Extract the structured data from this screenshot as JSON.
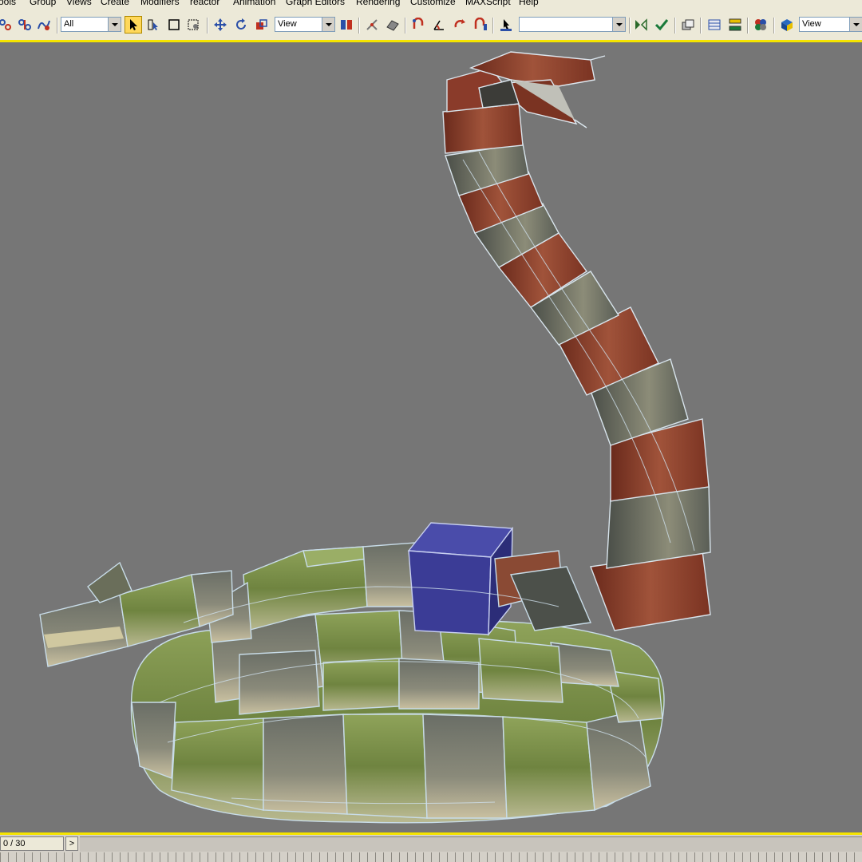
{
  "menu": {
    "items": [
      "ools",
      "Group",
      "Views",
      "Create",
      "Modifiers",
      "reactor",
      "Animation",
      "Graph Editors",
      "Rendering",
      "Customize",
      "MAXScript",
      "Help"
    ]
  },
  "toolbar": {
    "selection_filter": "All",
    "reference_coordinate": "View",
    "named_selection_set": "",
    "render_viewport": "View"
  },
  "timeslider": {
    "frame_indicator": "0 / 30",
    "next_label": ">"
  },
  "colors": {
    "selection_yellow": "#f5e400",
    "viewport_bg": "#767676",
    "snake_green": "#7c8f4a",
    "snake_red": "#8a3b2a",
    "snake_gray": "#5b5f58",
    "selected_box": "#3b3c96"
  }
}
